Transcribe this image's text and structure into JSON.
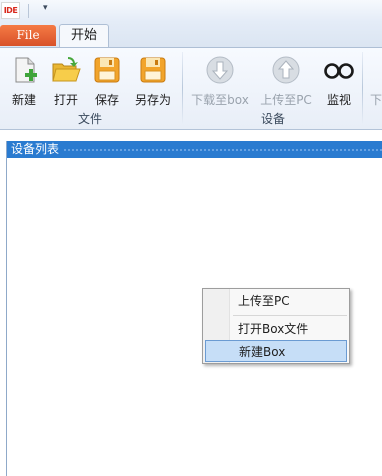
{
  "titlebar": {
    "logo_text": "IDE",
    "quick_access": "▾"
  },
  "tabs": [
    {
      "label": "File",
      "active": false
    },
    {
      "label": "开始",
      "active": true
    }
  ],
  "ribbon": {
    "groups": [
      {
        "label": "文件",
        "buttons": [
          {
            "label": "新建",
            "icon": "new-document-icon",
            "enabled": true
          },
          {
            "label": "打开",
            "icon": "open-folder-icon",
            "enabled": true
          },
          {
            "label": "保存",
            "icon": "save-disk-icon",
            "enabled": true
          },
          {
            "label": "另存为",
            "icon": "save-as-disk-icon",
            "enabled": true
          }
        ]
      },
      {
        "label": "设备",
        "buttons": [
          {
            "label": "下载至box",
            "icon": "download-arrow-icon",
            "enabled": false
          },
          {
            "label": "上传至PC",
            "icon": "upload-arrow-icon",
            "enabled": false
          },
          {
            "label": "监视",
            "icon": "glasses-icon",
            "enabled": true
          }
        ]
      }
    ],
    "overflow_label": "下"
  },
  "device_panel": {
    "title": "设备列表"
  },
  "context_menu": {
    "items": [
      {
        "label": "上传至PC",
        "highlighted": false
      },
      {
        "label": "打开Box文件",
        "highlighted": false
      },
      {
        "label": "新建Box",
        "highlighted": true
      }
    ]
  },
  "colors": {
    "file_tab": "#e0602f",
    "panel_header": "#2a7bd0",
    "menu_highlight": "#c6def7"
  }
}
